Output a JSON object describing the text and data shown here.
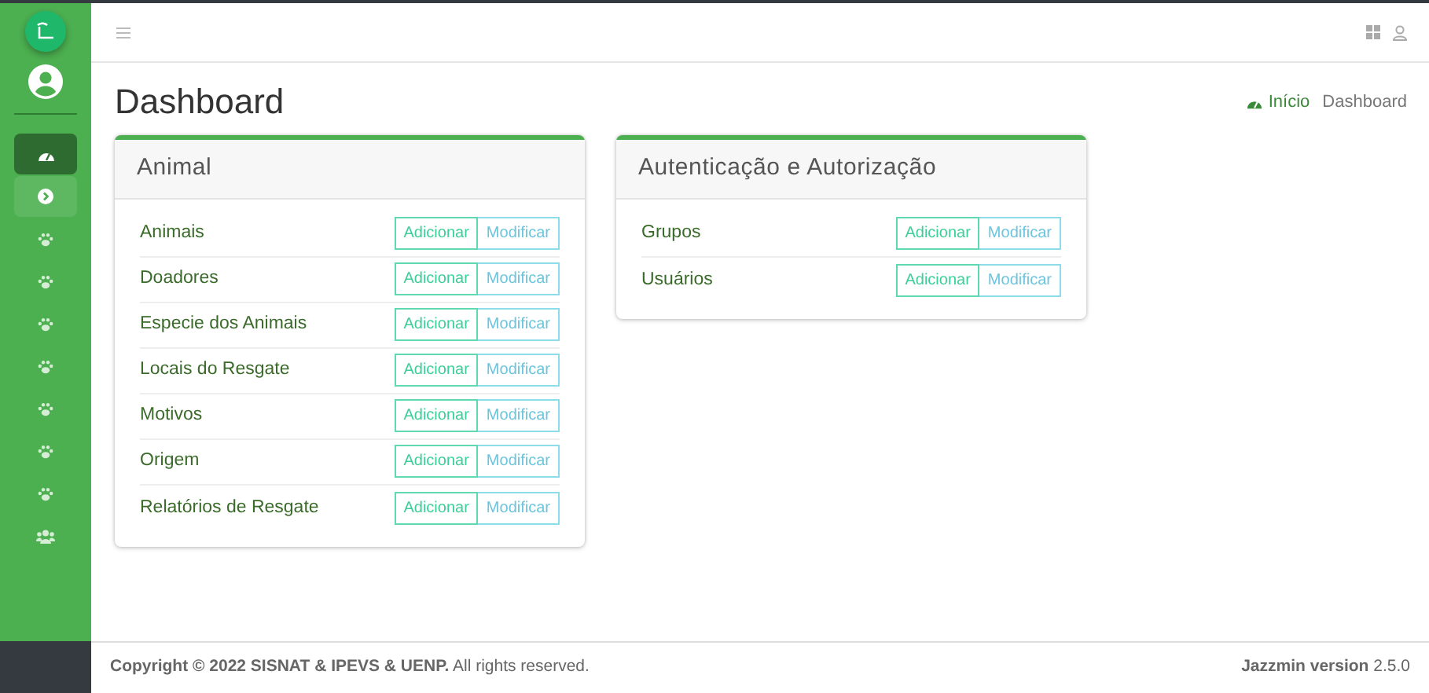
{
  "sidebar": {
    "items": [
      {
        "kind": "dashboard",
        "selected": true
      },
      {
        "kind": "expand",
        "selected": false
      },
      {
        "kind": "paw",
        "selected": false
      },
      {
        "kind": "paw",
        "selected": false
      },
      {
        "kind": "paw",
        "selected": false
      },
      {
        "kind": "paw",
        "selected": false
      },
      {
        "kind": "paw",
        "selected": false
      },
      {
        "kind": "paw",
        "selected": false
      },
      {
        "kind": "paw",
        "selected": false
      },
      {
        "kind": "group",
        "selected": false
      }
    ]
  },
  "page": {
    "title": "Dashboard",
    "breadcrumb": [
      "Início",
      "Dashboard"
    ]
  },
  "apps": [
    {
      "title": "Animal",
      "models": [
        {
          "name": "Animais",
          "add": "Adicionar",
          "change": "Modificar"
        },
        {
          "name": "Doadores",
          "add": "Adicionar",
          "change": "Modificar"
        },
        {
          "name": "Especie dos Animais",
          "add": "Adicionar",
          "change": "Modificar"
        },
        {
          "name": "Locais do Resgate",
          "add": "Adicionar",
          "change": "Modificar"
        },
        {
          "name": "Motivos",
          "add": "Adicionar",
          "change": "Modificar"
        },
        {
          "name": "Origem",
          "add": "Adicionar",
          "change": "Modificar"
        },
        {
          "name": "Relatórios de Resgate",
          "add": "Adicionar",
          "change": "Modificar"
        }
      ]
    },
    {
      "title": "Autenticação e Autorização",
      "models": [
        {
          "name": "Grupos",
          "add": "Adicionar",
          "change": "Modificar"
        },
        {
          "name": "Usuários",
          "add": "Adicionar",
          "change": "Modificar"
        }
      ]
    }
  ],
  "footer": {
    "copyright": "**Copyright © 2022 SISNAT & IPEVS & UENP.** All rights reserved.",
    "version": "**Jazzmin version** 2.5.0"
  }
}
